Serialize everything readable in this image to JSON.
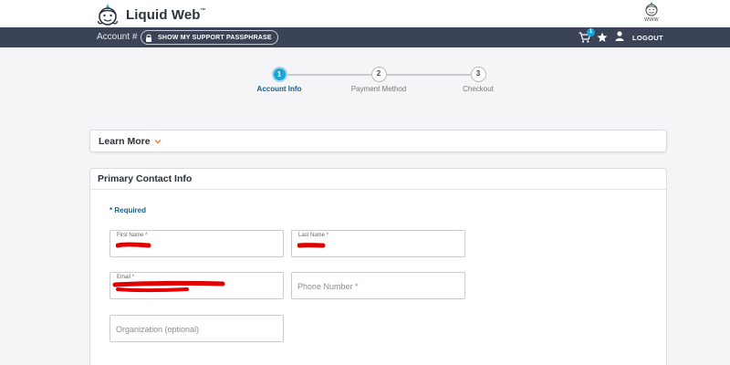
{
  "brand": {
    "name": "Liquid Web",
    "trademark": "™",
    "logo_icon": "liquid-web-face-icon"
  },
  "www_menu": {
    "label": "www",
    "icon": "www-face-icon"
  },
  "navbar": {
    "account_label": "Account #",
    "passphrase_button": "SHOW MY SUPPORT PASSPHRASE",
    "cart_count": "1",
    "logout": "LOGOUT",
    "background": "#3b4357"
  },
  "stepper": {
    "steps": [
      {
        "number": "1",
        "label": "Account Info",
        "state": "active"
      },
      {
        "number": "2",
        "label": "Payment Method",
        "state": "pending"
      },
      {
        "number": "3",
        "label": "Checkout",
        "state": "pending"
      }
    ],
    "accent": "#1aa3d6"
  },
  "learn_more": {
    "label": "Learn More"
  },
  "contact": {
    "title": "Primary Contact Info",
    "required_note": "* Required",
    "fields": {
      "first_name": {
        "label": "First Name *",
        "value": ""
      },
      "last_name": {
        "label": "Last Name *",
        "value": ""
      },
      "email": {
        "label": "Email *",
        "value": ""
      },
      "phone": {
        "placeholder": "Phone Number *"
      },
      "organization": {
        "placeholder": "Organization (optional)"
      }
    }
  }
}
